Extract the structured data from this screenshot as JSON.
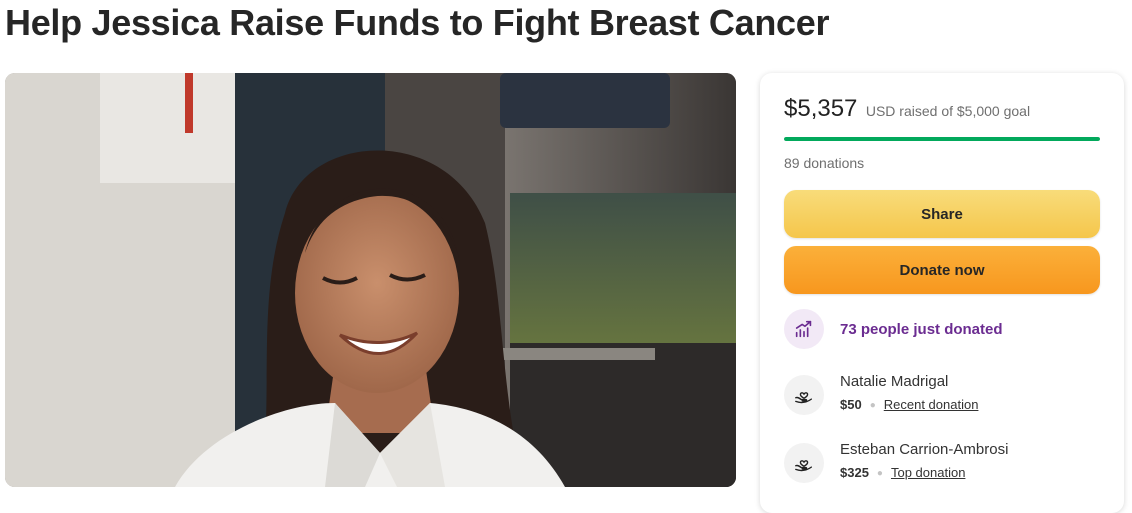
{
  "page": {
    "title": "Help Jessica Raise Funds to Fight Breast Cancer"
  },
  "hero": {
    "image_icon": "photo-of-smiling-woman"
  },
  "donation_card": {
    "amount_raised": "$5,357",
    "goal_text": "USD raised of $5,000 goal",
    "progress_fraction": 1.0,
    "donation_count": "89 donations",
    "share_label": "Share",
    "donate_label": "Donate now",
    "trending_text": "73 people just donated",
    "trending_icon": "trend-up-icon",
    "donors": [
      {
        "name": "Natalie Madrigal",
        "amount": "$50",
        "tag": "Recent donation",
        "icon": "heart-hand-icon"
      },
      {
        "name": "Esteban Carrion-Ambrosi",
        "amount": "$325",
        "tag": "Top donation",
        "icon": "heart-hand-icon"
      }
    ],
    "colors": {
      "progress": "#02a95c",
      "share_button": "#f5c64b",
      "donate_button": "#f7971e",
      "trending_text": "#6b2c91"
    }
  }
}
